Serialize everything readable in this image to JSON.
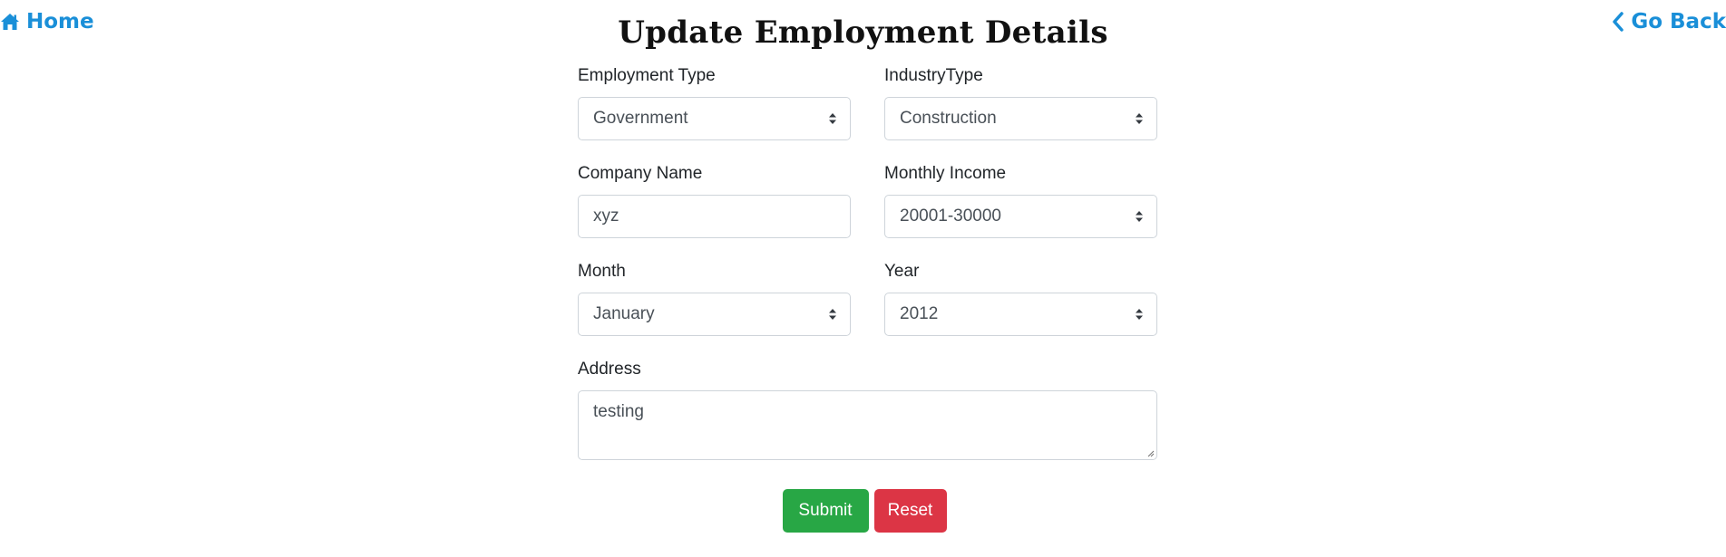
{
  "nav": {
    "home_label": "Home",
    "home_icon": "home-icon",
    "back_label": "Go Back",
    "back_icon": "chevron-left-icon",
    "link_color": "#1a8fd8"
  },
  "page": {
    "title": "Update Employment Details"
  },
  "form": {
    "employment_type": {
      "label": "Employment Type",
      "value": "Government"
    },
    "industry_type": {
      "label": "IndustryType",
      "value": "Construction"
    },
    "company_name": {
      "label": "Company Name",
      "value": "xyz"
    },
    "monthly_income": {
      "label": "Monthly Income",
      "value": "20001-30000"
    },
    "month": {
      "label": "Month",
      "value": "January"
    },
    "year": {
      "label": "Year",
      "value": "2012"
    },
    "address": {
      "label": "Address",
      "value": "testing"
    }
  },
  "buttons": {
    "submit_label": "Submit",
    "submit_color": "#28a745",
    "reset_label": "Reset",
    "reset_color": "#dc3545"
  }
}
